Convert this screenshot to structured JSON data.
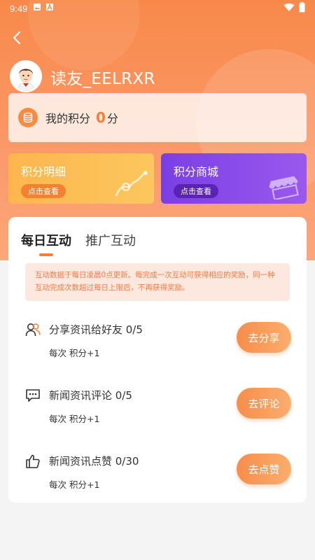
{
  "status_bar": {
    "time": "9:49",
    "icons": [
      "image-icon",
      "font-icon",
      "wifi-icon",
      "battery-icon"
    ]
  },
  "header": {
    "username": "读友_EELRXR"
  },
  "points": {
    "label": "我的积分",
    "value": "0",
    "unit": "分"
  },
  "quick_actions": [
    {
      "title": "积分明细",
      "button": "点击查看",
      "color": "#fdb64d"
    },
    {
      "title": "积分商城",
      "button": "点击查看",
      "color": "#7a3fe4"
    }
  ],
  "tabs": [
    {
      "label": "每日互动",
      "active": true
    },
    {
      "label": "推广互动",
      "active": false
    }
  ],
  "notice": "互动数据于每日凌晨0点更新。每完成一次互动可获得相应的奖励，同一种互动完成次数超过每日上限后，不再获得奖励。",
  "tasks": [
    {
      "icon": "users-icon",
      "name": "分享资讯给好友 0/5",
      "reward": "每次 积分+1",
      "button": "去分享"
    },
    {
      "icon": "comment-icon",
      "name": "新闻资讯评论 0/5",
      "reward": "每次 积分+1",
      "button": "去评论"
    },
    {
      "icon": "thumbs-up-icon",
      "name": "新闻资讯点赞 0/30",
      "reward": "每次 积分+1",
      "button": "去点赞"
    }
  ],
  "colors": {
    "accent": "#f57f3a",
    "hero_top": "#f8894a",
    "notice_bg": "#fde8df",
    "notice_text": "#f27a46"
  }
}
